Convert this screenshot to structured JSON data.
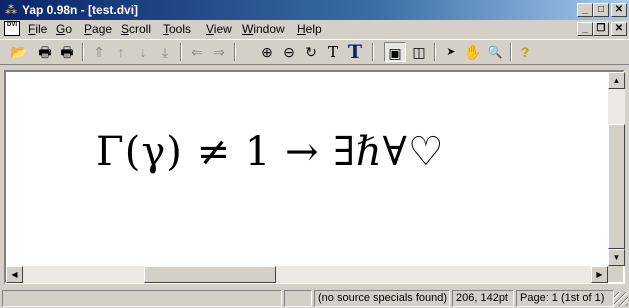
{
  "window": {
    "title": "Yap 0.98n - [test.dvi]",
    "controls": {
      "minimize": "_",
      "maximize": "□",
      "close": "✕"
    }
  },
  "menubar": {
    "doc_icon": "DVI",
    "items": [
      {
        "accel": "F",
        "rest": "ile"
      },
      {
        "accel": "G",
        "rest": "o"
      },
      {
        "accel": "P",
        "rest": "age"
      },
      {
        "accel": "S",
        "rest": "croll"
      },
      {
        "accel": "T",
        "rest": "ools"
      },
      {
        "accel": "V",
        "rest": "iew"
      },
      {
        "accel": "W",
        "rest": "indow"
      },
      {
        "accel": "H",
        "rest": "elp"
      }
    ],
    "mdi_controls": {
      "minimize": "_",
      "restore": "❐",
      "close": "✕"
    }
  },
  "toolbar": {
    "buttons": [
      {
        "icon": "open-folder-icon",
        "glyph": "📂",
        "enabled": true
      },
      {
        "icon": "print-icon",
        "glyph": "🖶",
        "enabled": true
      },
      {
        "icon": "print-preview-icon",
        "glyph": "🖶",
        "enabled": true
      },
      {
        "icon": "first-page-icon",
        "glyph": "⇑",
        "enabled": false
      },
      {
        "icon": "previous-page-icon",
        "glyph": "↑",
        "enabled": false
      },
      {
        "icon": "next-page-icon",
        "glyph": "↓",
        "enabled": false
      },
      {
        "icon": "last-page-icon",
        "glyph": "⤓",
        "enabled": false
      },
      {
        "icon": "back-icon",
        "glyph": "⇐",
        "enabled": false
      },
      {
        "icon": "forward-icon",
        "glyph": "⇒",
        "enabled": false
      },
      {
        "icon": "zoom-in-icon",
        "glyph": "⊕",
        "enabled": true
      },
      {
        "icon": "zoom-out-icon",
        "glyph": "⊖",
        "enabled": true
      },
      {
        "icon": "refresh-icon",
        "glyph": "↻",
        "enabled": true
      },
      {
        "icon": "small-font-icon",
        "glyph": "T",
        "enabled": true
      },
      {
        "icon": "large-font-icon",
        "glyph": "T",
        "enabled": true
      },
      {
        "icon": "single-page-icon",
        "glyph": "▣",
        "enabled": true,
        "pressed": true
      },
      {
        "icon": "double-page-icon",
        "glyph": "◫",
        "enabled": true
      },
      {
        "icon": "select-arrow-icon",
        "glyph": "➤",
        "enabled": true
      },
      {
        "icon": "hand-tool-icon",
        "glyph": "✋",
        "enabled": true
      },
      {
        "icon": "magnifier-icon",
        "glyph": "🔍",
        "enabled": true
      },
      {
        "icon": "help-icon",
        "glyph": "?",
        "enabled": true
      }
    ]
  },
  "document": {
    "formula": "Γ(γ) ≠ 1 → ∃ℏ∀♡"
  },
  "scrollbars": {
    "up": "▲",
    "down": "▼",
    "left": "◀",
    "right": "▶"
  },
  "statusbar": {
    "source_specials": "(no source specials found)",
    "position": "206, 142pt",
    "page": "Page: 1 (1st of 1)"
  },
  "colors": {
    "titlebar_start": "#0a246a",
    "titlebar_end": "#a6caf0",
    "face": "#d4d0c8",
    "canvas": "#ffffff"
  }
}
